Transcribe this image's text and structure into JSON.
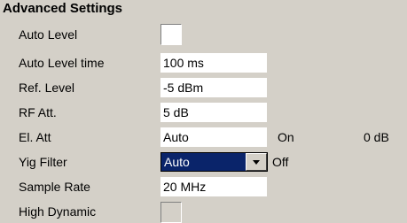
{
  "section_title": "Advanced Settings",
  "rows": {
    "auto_level": {
      "label": "Auto Level",
      "checked": false
    },
    "auto_level_time": {
      "label": "Auto Level time",
      "value": "100 ms"
    },
    "ref_level": {
      "label": "Ref. Level",
      "value": "-5 dBm"
    },
    "rf_att": {
      "label": "RF Att.",
      "value": "5 dB"
    },
    "el_att": {
      "label": "El. Att",
      "value": "Auto",
      "state": "On",
      "amount": "0 dB"
    },
    "yig_filter": {
      "label": "Yig Filter",
      "selected": "Auto",
      "state": "Off"
    },
    "sample_rate": {
      "label": "Sample Rate",
      "value": "20 MHz"
    },
    "high_dynamic": {
      "label": "High Dynamic",
      "checked": false,
      "enabled": false
    }
  },
  "icons": {
    "dropdown": "chevron-down-icon"
  },
  "colors": {
    "background": "#d4d0c8",
    "field": "#ffffff",
    "selection": "#0a246a"
  }
}
